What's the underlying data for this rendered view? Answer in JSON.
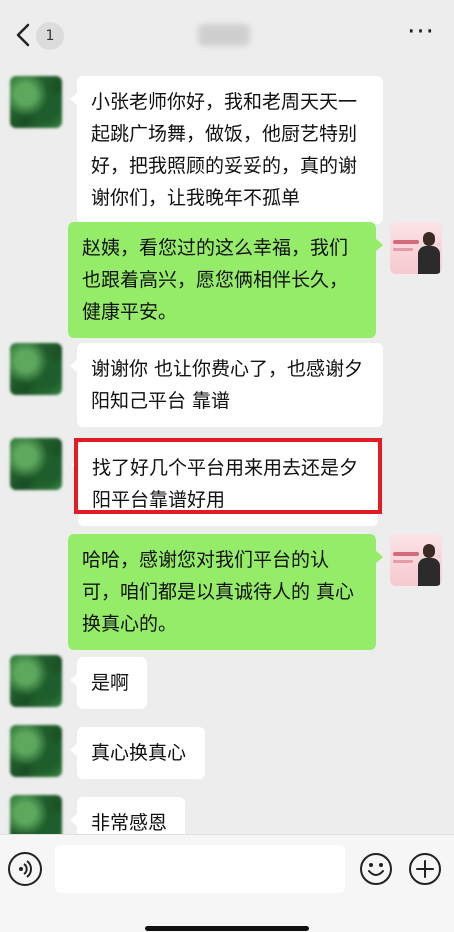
{
  "header": {
    "unread_count": "1",
    "more_label": "···"
  },
  "messages": [
    {
      "side": "left",
      "text": "小张老师你好，我和老周天天一起跳广场舞，做饭，他厨艺特别好，把我照顾的妥妥的，真的谢谢你们，让我晚年不孤单"
    },
    {
      "side": "right",
      "text": "赵姨，看您过的这么幸福，我们也跟着高兴，愿您俩相伴长久，健康平安。"
    },
    {
      "side": "left",
      "text": "谢谢你 也让你费心了，也感谢夕阳知己平台 靠谱"
    },
    {
      "side": "left",
      "text": "找了好几个平台用来用去还是夕阳平台靠谱好用",
      "highlighted": true
    },
    {
      "side": "right",
      "text": "哈哈，感谢您对我们平台的认可，咱们都是以真诚待人的 真心换真心的。"
    },
    {
      "side": "left",
      "text": "是啊"
    },
    {
      "side": "left",
      "text": "真心换真心"
    },
    {
      "side": "left",
      "text": "非常感恩"
    }
  ],
  "input_bar": {
    "value": "",
    "placeholder": ""
  },
  "colors": {
    "background": "#ededed",
    "bubble_self": "#95ec69",
    "bubble_other": "#ffffff",
    "highlight": "#e21b24"
  },
  "icons": [
    "back-icon",
    "more-icon",
    "voice-icon",
    "emoji-icon",
    "plus-icon"
  ]
}
